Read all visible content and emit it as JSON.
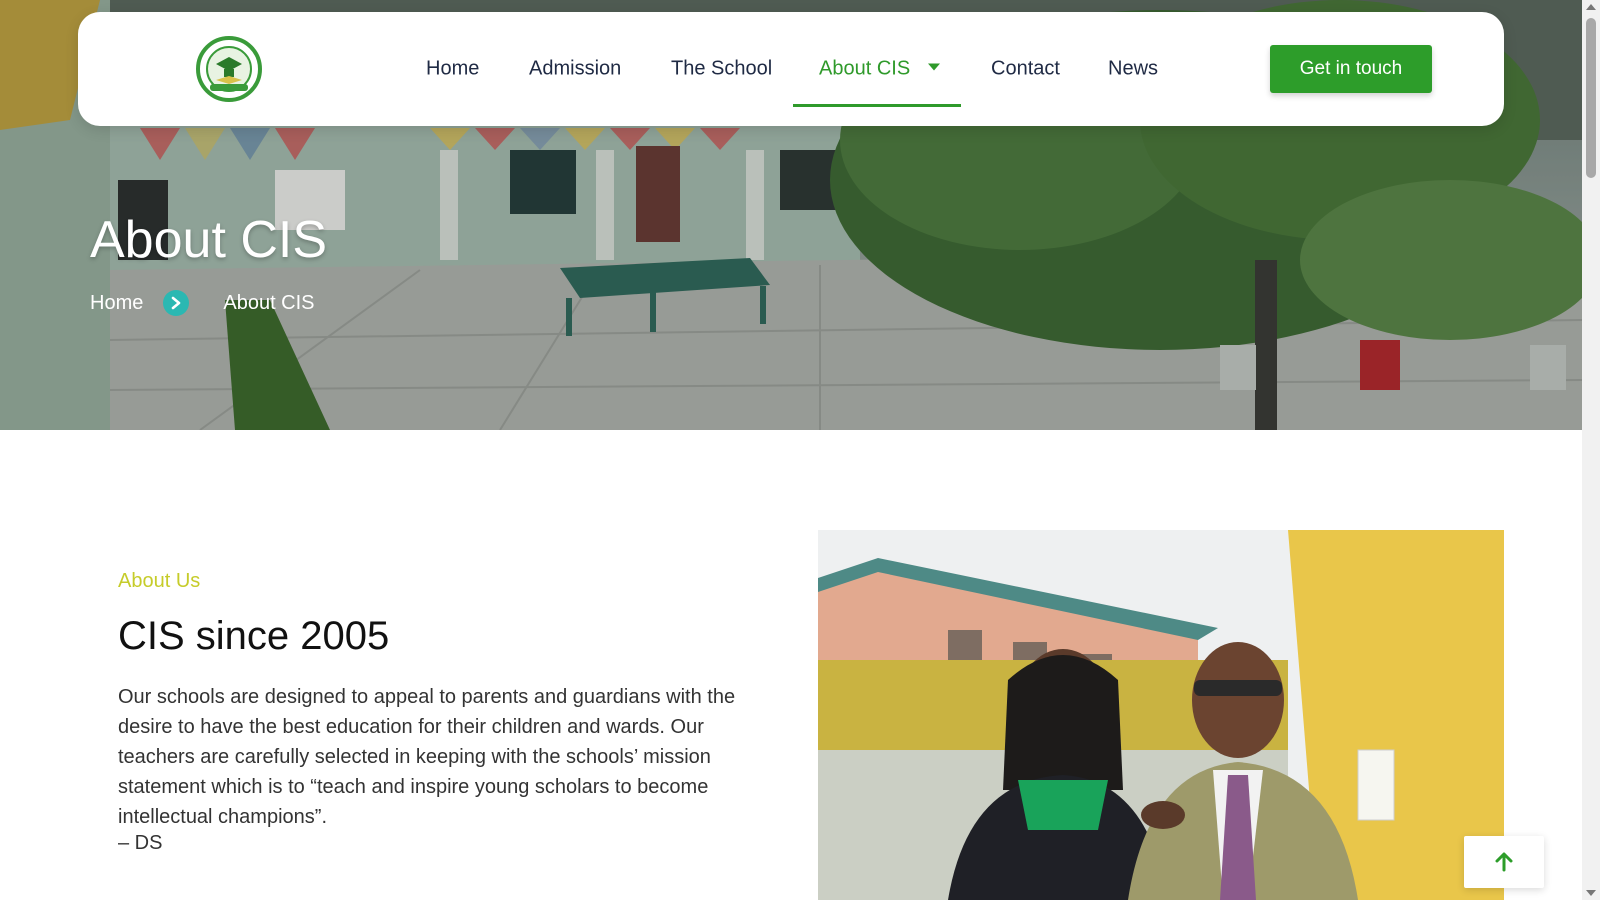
{
  "nav": {
    "logo_alt": "Champions International Schools",
    "items": [
      {
        "label": "Home"
      },
      {
        "label": "Admission"
      },
      {
        "label": "The School"
      },
      {
        "label": "About CIS",
        "active": true
      },
      {
        "label": "Contact"
      },
      {
        "label": "News"
      }
    ],
    "cta_label": "Get in touch"
  },
  "hero": {
    "title": "About CIS",
    "breadcrumb": {
      "home": "Home",
      "current": "About CIS"
    }
  },
  "about": {
    "eyebrow": "About Us",
    "title": "CIS since 2005",
    "body": "Our schools are designed to appeal to parents and guardians with the desire to have the best education for their children and wards. Our teachers are carefully selected in keeping with the schools’ mission statement which is to “teach and inspire young scholars to become intellectual champions”.",
    "signature": "– DS"
  },
  "icons": {
    "breadcrumb_separator": "chevron-right-icon",
    "dropdown": "caret-down-icon",
    "back_to_top": "arrow-up-icon"
  },
  "colors": {
    "brand_green": "#2d9d2a",
    "eyebrow_yellow": "#c6cc2a",
    "breadcrumb_teal": "#2bb8b2",
    "nav_text": "#1f2a44"
  }
}
